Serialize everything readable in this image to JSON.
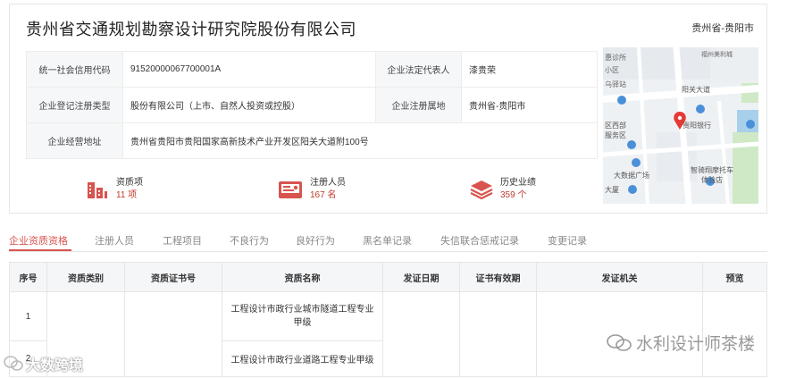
{
  "company": {
    "name": "贵州省交通规划勘察设计研究院股份有限公司",
    "region": "贵州省-贵阳市"
  },
  "info": {
    "credit_code_label": "统一社会信用代码",
    "credit_code_value": "91520000067700001A",
    "legal_rep_label": "企业法定代表人",
    "legal_rep_value": "漆贵荣",
    "reg_type_label": "企业登记注册类型",
    "reg_type_value": "股份有限公司（上市、自然人投资或控股）",
    "reg_place_label": "企业注册属地",
    "reg_place_value": "贵州省-贵阳市",
    "address_label": "企业经营地址",
    "address_value": "贵州省贵阳市贵阳国家高新技术产业开发区阳关大道附100号"
  },
  "stats": [
    {
      "label": "资质项",
      "value": "11 项",
      "icon": "building-icon",
      "color": "#d9534f"
    },
    {
      "label": "注册人员",
      "value": "167 名",
      "icon": "id-card-icon",
      "color": "#d9534f"
    },
    {
      "label": "历史业绩",
      "value": "359 个",
      "icon": "layers-icon",
      "color": "#d9534f"
    }
  ],
  "map": {
    "labels": [
      "惠诊所",
      "小区",
      "乌驿站",
      "阳关大道",
      "区西部",
      "服务区",
      "贵阳银行",
      "大数据广场",
      "智骑翔摩托车体验店",
      "大厦",
      "福州美利城"
    ]
  },
  "tabs": [
    "企业资质资格",
    "注册人员",
    "工程项目",
    "不良行为",
    "良好行为",
    "黑名单记录",
    "失信联合惩戒记录",
    "变更记录"
  ],
  "table": {
    "headers": [
      "序号",
      "资质类别",
      "资质证书号",
      "资质名称",
      "发证日期",
      "证书有效期",
      "发证机关",
      "预览"
    ],
    "rows": [
      {
        "index": "1",
        "name": "工程设计市政行业城市隧道工程专业甲级"
      },
      {
        "index": "2",
        "name": "工程设计市政行业道路工程专业甲级"
      }
    ]
  },
  "watermarks": {
    "right": "水利设计师茶楼",
    "left": "大数跨境"
  },
  "colors": {
    "accent": "#d9534f",
    "header_bg": "#f5f6f8",
    "key_bg": "#f6f7f9"
  }
}
